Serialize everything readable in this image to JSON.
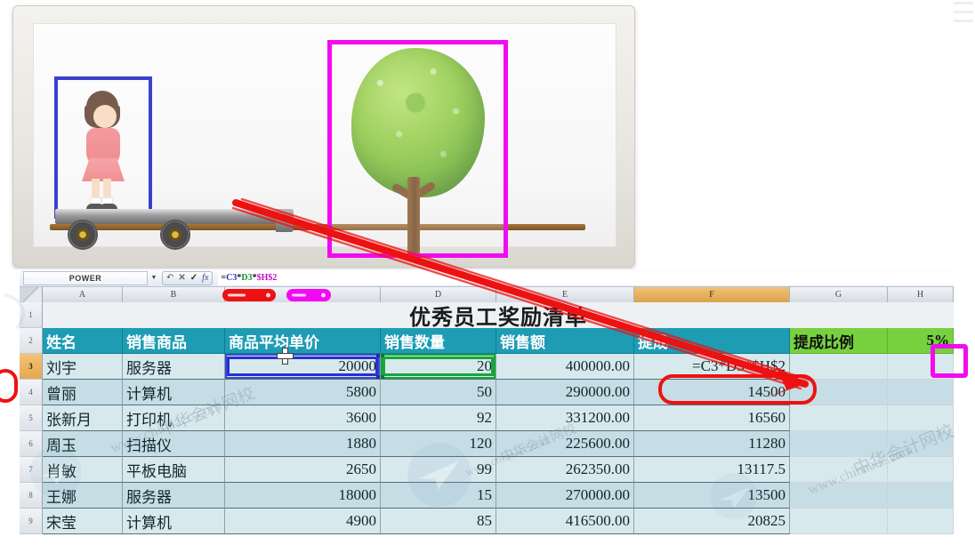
{
  "slide": {
    "caption_alt": "teaching illustration: girl on cart and tree",
    "girl_label": "girl-figure",
    "tree_label": "tree-figure",
    "box_blue_color": "#3d3fd0",
    "box_magenta_color": "#f20af2",
    "arrow_color": "#ee1111"
  },
  "excel": {
    "name_box": "POWER",
    "name_box_dropdown": "▼",
    "formula_buttons": {
      "undo": "↶",
      "cancel": "✕",
      "enter": "✓",
      "fx": "fx"
    },
    "formula_tokens": [
      {
        "t": "=",
        "c": "op"
      },
      {
        "t": "C3",
        "c": "blue"
      },
      {
        "t": "*",
        "c": "op"
      },
      {
        "t": "D3",
        "c": "green"
      },
      {
        "t": "*",
        "c": "op"
      },
      {
        "t": "$H$2",
        "c": "mag"
      }
    ],
    "formula_text": "=C3*D3*$H$2",
    "columns": [
      {
        "label": "A",
        "width": 90,
        "selected": false
      },
      {
        "label": "B",
        "width": 115,
        "selected": false
      },
      {
        "label": "C",
        "width": 175,
        "selected": false
      },
      {
        "label": "D",
        "width": 130,
        "selected": false
      },
      {
        "label": "E",
        "width": 155,
        "selected": false
      },
      {
        "label": "F",
        "width": 175,
        "selected": true
      },
      {
        "label": "G",
        "width": 110,
        "selected": false
      },
      {
        "label": "H",
        "width": 74,
        "selected": false
      }
    ],
    "rows": [
      {
        "num": "1",
        "kind": "title",
        "selected": false,
        "title": "优秀员工奖励清单"
      },
      {
        "num": "2",
        "kind": "header",
        "selected": false,
        "cells": [
          "姓名",
          "销售商品",
          "商品平均单价",
          "销售数量",
          "销售额",
          "提成",
          "提成比例",
          "5%"
        ]
      },
      {
        "num": "3",
        "kind": "data",
        "selected": true,
        "cells": [
          "刘宇",
          "服务器",
          "20000",
          "20",
          "400000.00",
          "=C3*D3*$H$2",
          "",
          ""
        ]
      },
      {
        "num": "4",
        "kind": "data",
        "selected": false,
        "cells": [
          "曾丽",
          "计算机",
          "5800",
          "50",
          "290000.00",
          "14500",
          "",
          ""
        ]
      },
      {
        "num": "5",
        "kind": "data",
        "selected": false,
        "cells": [
          "张新月",
          "打印机",
          "3600",
          "92",
          "331200.00",
          "16560",
          "",
          ""
        ]
      },
      {
        "num": "6",
        "kind": "data",
        "selected": false,
        "cells": [
          "周玉",
          "扫描仪",
          "1880",
          "120",
          "225600.00",
          "11280",
          "",
          ""
        ]
      },
      {
        "num": "7",
        "kind": "data",
        "selected": false,
        "cells": [
          "肖敏",
          "平板电脑",
          "2650",
          "99",
          "262350.00",
          "13117.5",
          "",
          ""
        ]
      },
      {
        "num": "8",
        "kind": "data",
        "selected": false,
        "cells": [
          "王娜",
          "服务器",
          "18000",
          "15",
          "270000.00",
          "13500",
          "",
          ""
        ]
      },
      {
        "num": "9",
        "kind": "data",
        "selected": false,
        "cells": [
          "宋莹",
          "计算机",
          "4900",
          "85",
          "416500.00",
          "20825",
          "",
          ""
        ]
      }
    ],
    "annotations": {
      "red_pill_label": "red-marker-pill-over-column-header",
      "magenta_pill_label": "magenta-marker-pill-over-column-header",
      "red_ring_label": "red-ring-around-formula-cell",
      "magenta_ring_label": "magenta-ring-around-rate-cell",
      "red_ring_small_label": "red-ring-left-gutter"
    }
  },
  "watermarks": {
    "text_a": "www.chinaacc.com",
    "text_b": "中华会计网校",
    "text_c": "www.chinaacc.com",
    "text_d": "中华会计网校"
  }
}
